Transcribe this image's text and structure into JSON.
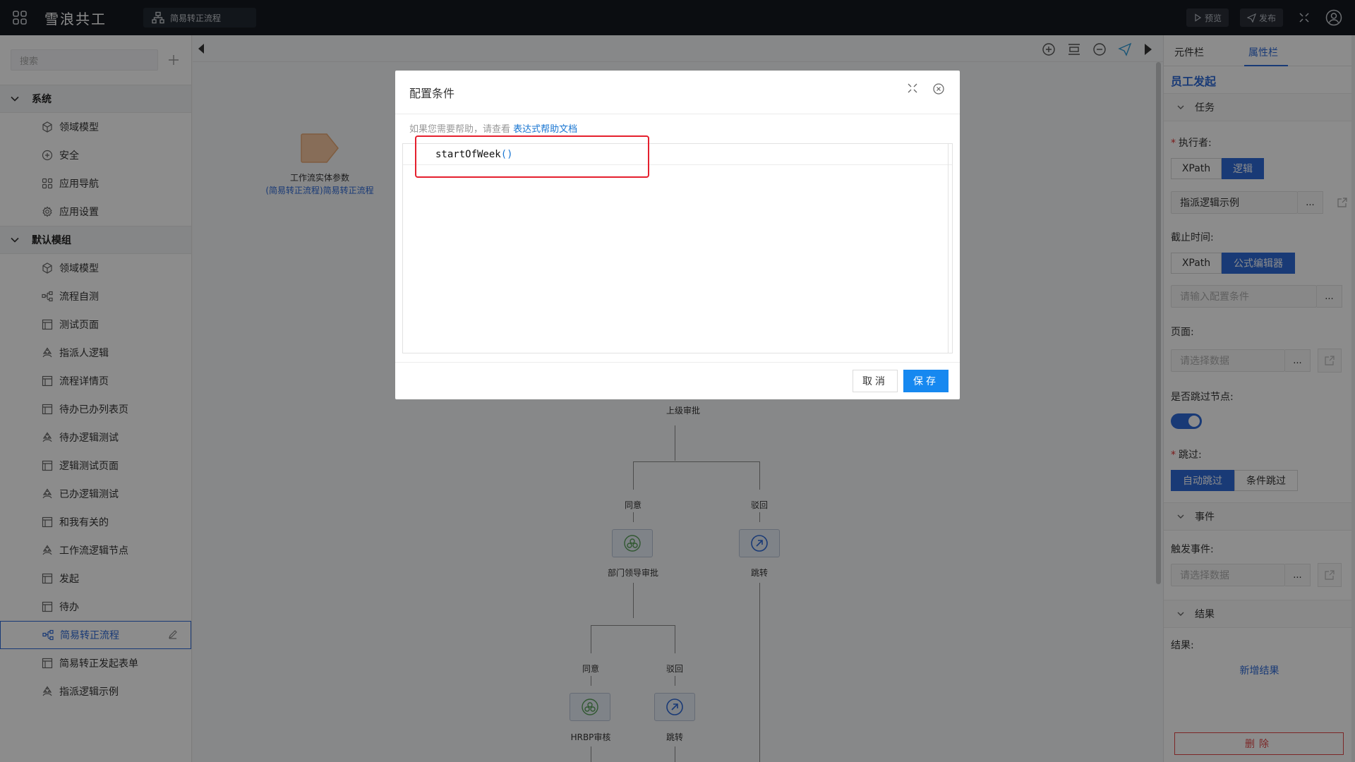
{
  "topbar": {
    "app_title": "雪浪共工",
    "flow_tab": "简易转正流程",
    "preview_label": "预览",
    "publish_label": "发布"
  },
  "sidebar": {
    "search_placeholder": "搜索",
    "groups": [
      {
        "title": "系统",
        "items": [
          {
            "label": "领域模型",
            "icon": "cube-icon"
          },
          {
            "label": "安全",
            "icon": "shield-plus-icon"
          },
          {
            "label": "应用导航",
            "icon": "grid-icon"
          },
          {
            "label": "应用设置",
            "icon": "gear-icon"
          }
        ]
      },
      {
        "title": "默认模组",
        "items": [
          {
            "label": "领域模型",
            "icon": "cube-icon"
          },
          {
            "label": "流程自测",
            "icon": "flow-icon"
          },
          {
            "label": "测试页面",
            "icon": "page-icon"
          },
          {
            "label": "指派人逻辑",
            "icon": "logic-icon"
          },
          {
            "label": "流程详情页",
            "icon": "page-icon"
          },
          {
            "label": "待办已办列表页",
            "icon": "page-icon"
          },
          {
            "label": "待办逻辑测试",
            "icon": "logic-icon"
          },
          {
            "label": "逻辑测试页面",
            "icon": "page-icon"
          },
          {
            "label": "已办逻辑测试",
            "icon": "logic-icon"
          },
          {
            "label": "和我有关的",
            "icon": "page-icon"
          },
          {
            "label": "工作流逻辑节点",
            "icon": "logic-icon"
          },
          {
            "label": "发起",
            "icon": "page-icon"
          },
          {
            "label": "待办",
            "icon": "page-icon"
          },
          {
            "label": "简易转正流程",
            "icon": "flow-icon",
            "active": true
          },
          {
            "label": "简易转正发起表单",
            "icon": "page-icon"
          },
          {
            "label": "指派逻辑示例",
            "icon": "logic-icon"
          }
        ]
      }
    ]
  },
  "canvas": {
    "entity_label": "工作流实体参数",
    "entity_sub": "(简易转正流程)简易转正流程",
    "superior_approval": "上级审批",
    "agree1": "同意",
    "reject1": "驳回",
    "dept_approval": "部门领导审批",
    "jump1": "跳转",
    "agree2": "同意",
    "reject2": "驳回",
    "hrbp": "HRBP审核",
    "jump2": "跳转"
  },
  "rpanel": {
    "tab_components": "元件栏",
    "tab_properties": "属性栏",
    "title": "员工发起",
    "section_task": "任务",
    "executor_label": "执行者:",
    "executor_opt1": "XPath",
    "executor_opt2": "逻辑",
    "executor_value": "指派逻辑示例",
    "deadline_label": "截止时间:",
    "deadline_opt1": "XPath",
    "deadline_opt2": "公式编辑器",
    "deadline_placeholder": "请输入配置条件",
    "page_label": "页面:",
    "page_placeholder": "请选择数据",
    "skip_node_label": "是否跳过节点:",
    "skip_label": "跳过:",
    "skip_opt1": "自动跳过",
    "skip_opt2": "条件跳过",
    "section_event": "事件",
    "trigger_label": "触发事件:",
    "trigger_placeholder": "请选择数据",
    "section_result": "结果",
    "result_label": "结果:",
    "add_result": "新增结果",
    "delete_label": "删除",
    "dots": "..."
  },
  "modal": {
    "title": "配置条件",
    "help_text": "如果您需要帮助，请查看",
    "help_link": "表达式帮助文档",
    "code_fn": "startOfWeek",
    "code_paren": "()",
    "cancel_label": "取消",
    "save_label": "保存"
  },
  "colors": {
    "accent": "#2f6bd8",
    "save_button": "#1688f0",
    "highlight_border": "#e5202e",
    "topbar": "#141820"
  }
}
